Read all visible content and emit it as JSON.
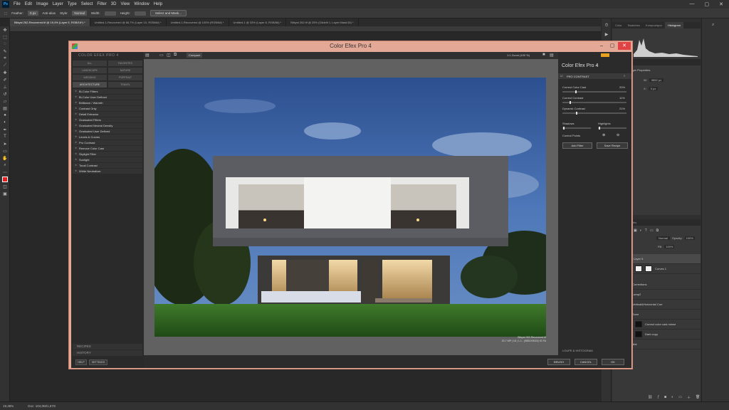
{
  "photoshop": {
    "logo": "Ps",
    "menu": [
      "File",
      "Edit",
      "Image",
      "Layer",
      "Type",
      "Select",
      "Filter",
      "3D",
      "View",
      "Window",
      "Help"
    ],
    "options": {
      "feather_label": "Feather:",
      "feather_value": "0 px",
      "antialias_label": "Anti-alias",
      "style_label": "Style:",
      "style_value": "Normal",
      "width_label": "Width:",
      "height_label": "Height:",
      "select_mask_button": "Select and Mask..."
    },
    "doc_tabs": [
      "Bilsyst 262-Recovered.tif @ 19,4% (Layer 5, RGB/16*) *",
      "Untitled-1-Recovered @ 66,7% (Layer 10, RGB/8#) *",
      "Untitled-1-Recovered @ 100% (RGB/8#) *",
      "Untitled-1 @ 33% (Layer 8, RGB/8#) *",
      "Bilsyst 262.tif @ 25% (Glidelit 1, Layer Mask/16) *"
    ],
    "status": {
      "zoom": "19,38%",
      "doc": "Doc: 104,0M/1,57G"
    },
    "panel_tabs_top": [
      "Color",
      "Swatches",
      "Kompozisjon",
      "Histogram"
    ],
    "adjustments_header": "Adjustments",
    "properties_header": "Layer Properties",
    "properties": {
      "w_label": "W:",
      "w_value": "9852 px",
      "x_label": "X:",
      "x_value": "0 px"
    },
    "layers_tabs": [
      "Layers",
      "Paths"
    ],
    "layers_blend": "Normal",
    "layers_opacity_label": "Opacity:",
    "layers_opacity": "100%",
    "layers_fill_label": "Fill:",
    "layers_fill": "100%",
    "layers": [
      {
        "name": "Layer 5"
      },
      {
        "name": "Curves 1"
      },
      {
        "name": "Corrections"
      },
      {
        "name": "Lamp2"
      },
      {
        "name": "Vertical&Horizontal Corr"
      },
      {
        "name": "Sone"
      },
      {
        "name": "Correct color cast minne"
      },
      {
        "name": "Dark copy"
      },
      {
        "name": "Mal"
      }
    ]
  },
  "cef": {
    "title": "Color Efex Pro 4",
    "panel_title": "COLOR EFEX PRO 4",
    "categories": [
      "ALL",
      "FAVORITES",
      "LANDSCAPE",
      "NATURE",
      "WEDDING",
      "PORTRAIT",
      "ARCHITECTURE",
      "TRAVEL"
    ],
    "filters": [
      "Bi-Color Filters",
      "Bi-Color User Defined",
      "Brilliance / Warmth",
      "Contrast Only",
      "Detail Extractor",
      "Graduated Filters",
      "Graduated Neutral Density",
      "Graduated User Defined",
      "Levels & Curves",
      "Pro Contrast",
      "Remove Color Cast",
      "Skylight Filter",
      "Sunlight",
      "Tonal Contrast",
      "White Neutralizer"
    ],
    "recipes_label": "RECIPES",
    "history_label": "HISTORY",
    "help_button": "HELP",
    "settings_button": "SETTINGS",
    "compare_button": "Compare",
    "zoom_label": "1:1 Zoom (100 %)",
    "caption_line1": "Bilsyst 262-Recovered.tif",
    "caption_line2": "20.7 MP | 16 | 1.1 - (9852X9024) IG FA",
    "brand_title": "Color Efex Pro",
    "brand_version": "4",
    "filter_name": "PRO CONTRAST",
    "sliders": [
      {
        "label": "Correct Color Cast",
        "value": "20%",
        "pct": 0.2
      },
      {
        "label": "Correct Contrast",
        "value": "11%",
        "pct": 0.11
      },
      {
        "label": "Dynamic Contrast",
        "value": "21%",
        "pct": 0.21
      }
    ],
    "shadows_label": "Shadows",
    "highlights_label": "Highlights",
    "control_points_label": "Control Points",
    "add_filter_button": "Add Filter",
    "save_recipe_button": "Save Recipe",
    "loupe_label": "LOUPE & HISTOGRAM",
    "brush_button": "BRUSH",
    "cancel_button": "CANCEL",
    "ok_button": "OK"
  }
}
